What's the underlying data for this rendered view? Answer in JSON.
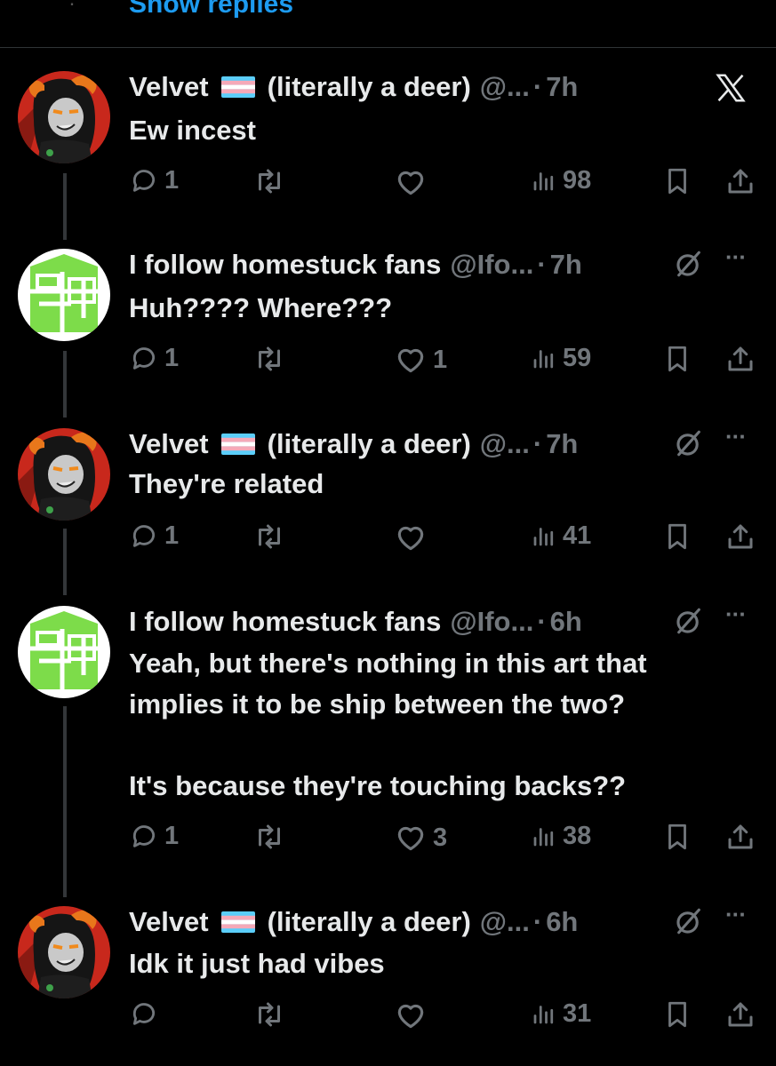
{
  "header": {
    "show_replies": "Show replies"
  },
  "tweets": [
    {
      "name": "Velvet",
      "suffix": "(literally a deer)",
      "handle": "@...",
      "time": "7h",
      "text": [
        "Ew incest"
      ],
      "replies": "1",
      "retweets": "",
      "likes": "",
      "views": "98",
      "right_icon": "x-logo-icon"
    },
    {
      "name": "I follow homestuck fans",
      "suffix": "",
      "handle": "@Ifo...",
      "time": "7h",
      "text": [
        "Huh???? Where???"
      ],
      "replies": "1",
      "retweets": "",
      "likes": "1",
      "views": "59",
      "right_icon": "grok-icon"
    },
    {
      "name": "Velvet",
      "suffix": "(literally a deer)",
      "handle": "@...",
      "time": "7h",
      "text": [
        "They're related"
      ],
      "replies": "1",
      "retweets": "",
      "likes": "",
      "views": "41",
      "right_icon": "grok-icon"
    },
    {
      "name": "I follow homestuck fans",
      "suffix": "",
      "handle": "@Ifo...",
      "time": "6h",
      "text": [
        "Yeah, but there's nothing in this art that",
        "implies it to be ship between the two?",
        "",
        "It's because they're touching backs??"
      ],
      "replies": "1",
      "retweets": "",
      "likes": "3",
      "views": "38",
      "right_icon": "grok-icon"
    },
    {
      "name": "Velvet",
      "suffix": "(literally a deer)",
      "handle": "@...",
      "time": "6h",
      "text": [
        "Idk it just had vibes"
      ],
      "replies": "",
      "retweets": "",
      "likes": "",
      "views": "31",
      "right_icon": "grok-icon"
    }
  ],
  "colors": {
    "background": "#000000",
    "text": "#e7e9ea",
    "muted": "#71767b",
    "link": "#1d9bf0",
    "thread_line": "#333639",
    "homestuck_green": "#7ddc4a"
  }
}
